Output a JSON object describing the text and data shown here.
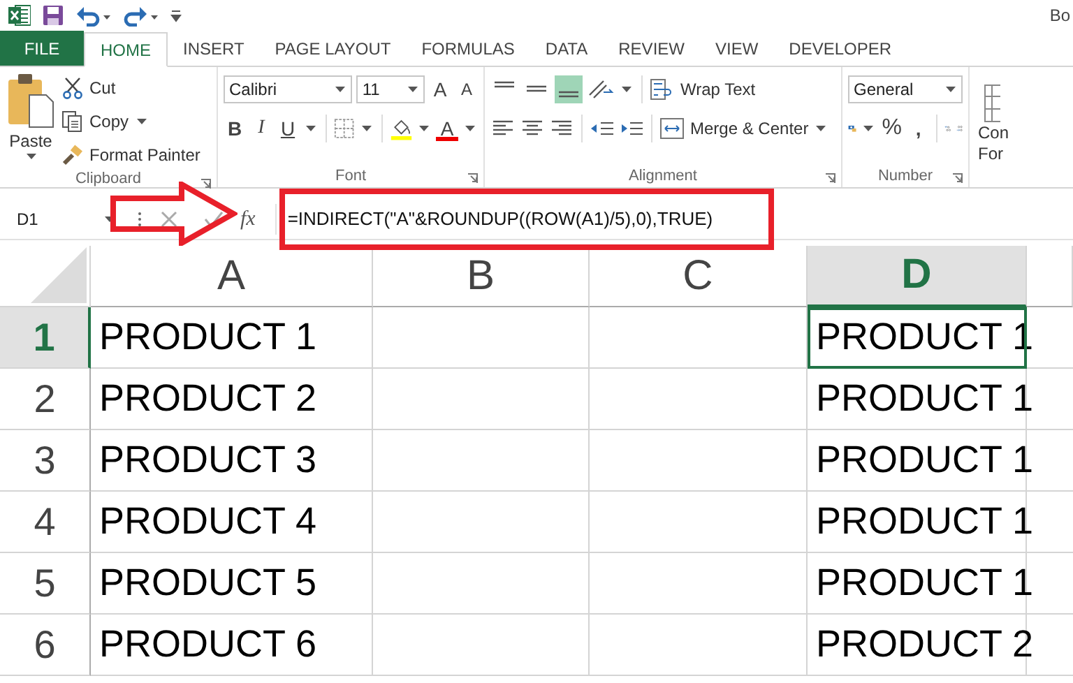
{
  "title_bar": {
    "title": "Bo"
  },
  "tabs": [
    {
      "label": "FILE",
      "kind": "file",
      "selected": false
    },
    {
      "label": "HOME",
      "kind": "tab",
      "selected": true
    },
    {
      "label": "INSERT",
      "kind": "tab",
      "selected": false
    },
    {
      "label": "PAGE LAYOUT",
      "kind": "tab",
      "selected": false
    },
    {
      "label": "FORMULAS",
      "kind": "tab",
      "selected": false
    },
    {
      "label": "DATA",
      "kind": "tab",
      "selected": false
    },
    {
      "label": "REVIEW",
      "kind": "tab",
      "selected": false
    },
    {
      "label": "VIEW",
      "kind": "tab",
      "selected": false
    },
    {
      "label": "DEVELOPER",
      "kind": "tab",
      "selected": false
    }
  ],
  "ribbon": {
    "clipboard": {
      "label": "Clipboard",
      "paste": "Paste",
      "cut": "Cut",
      "copy": "Copy",
      "format_painter": "Format Painter"
    },
    "font": {
      "label": "Font",
      "font_name": "Calibri",
      "font_size": "11",
      "grow": "A",
      "shrink": "A",
      "bold": "B",
      "italic": "I",
      "underline": "U",
      "font_color": "A"
    },
    "alignment": {
      "label": "Alignment",
      "vertical_align": [
        {
          "selected": false
        },
        {
          "selected": false
        },
        {
          "selected": true
        }
      ],
      "wrap_text": "Wrap Text",
      "merge_center": "Merge & Center"
    },
    "number": {
      "label": "Number",
      "format": "General",
      "percent": "%",
      "comma": ","
    },
    "styles": {
      "line_1": "Con",
      "line_2": "For"
    }
  },
  "formula_bar": {
    "name_box": "D1",
    "fx": "fx",
    "formula": "=INDIRECT(\"A\"&ROUNDUP((ROW(A1)/5),0),TRUE)"
  },
  "sheet": {
    "columns": [
      {
        "label": "A",
        "selected": false,
        "cells": [
          {
            "text": "PRODUCT 1",
            "selected": false
          },
          {
            "text": "PRODUCT 2",
            "selected": false
          },
          {
            "text": "PRODUCT 3",
            "selected": false
          },
          {
            "text": "PRODUCT 4",
            "selected": false
          },
          {
            "text": "PRODUCT 5",
            "selected": false
          },
          {
            "text": "PRODUCT 6",
            "selected": false
          }
        ]
      },
      {
        "label": "B",
        "selected": false
      },
      {
        "label": "C",
        "selected": false
      },
      {
        "label": "D",
        "selected": true,
        "cells": [
          {
            "text": "PRODUCT 1",
            "selected": true
          },
          {
            "text": "PRODUCT 1",
            "selected": false
          },
          {
            "text": "PRODUCT 1",
            "selected": false
          },
          {
            "text": "PRODUCT 1",
            "selected": false
          },
          {
            "text": "PRODUCT 1",
            "selected": false
          },
          {
            "text": "PRODUCT 2",
            "selected": false
          }
        ]
      }
    ],
    "rows": [
      {
        "label": "1",
        "selected": true
      },
      {
        "label": "2",
        "selected": false
      },
      {
        "label": "3",
        "selected": false
      },
      {
        "label": "4",
        "selected": false
      },
      {
        "label": "5",
        "selected": false
      },
      {
        "label": "6",
        "selected": false
      }
    ]
  },
  "annotations": [
    {
      "kind": "arrow"
    },
    {
      "kind": "box"
    }
  ]
}
